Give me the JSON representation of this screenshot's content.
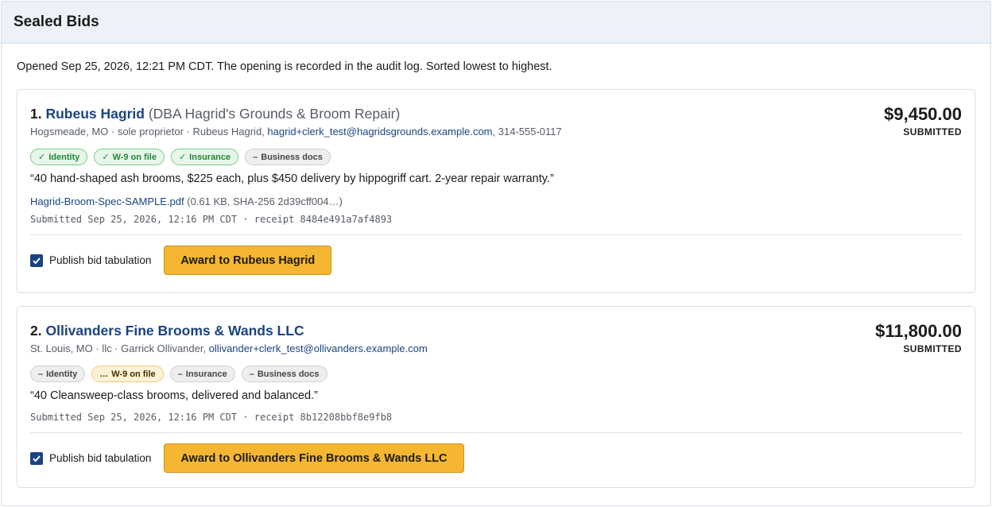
{
  "panel": {
    "title": "Sealed Bids",
    "intro": "Opened Sep 25, 2026, 12:21 PM CDT. The opening is recorded in the audit log. Sorted lowest to highest."
  },
  "bids": [
    {
      "rank": "1.",
      "name": "Rubeus Hagrid",
      "dba": "(DBA Hagrid's Grounds & Broom Repair)",
      "meta_prefix": "Hogsmeade, MO · sole proprietor · Rubeus Hagrid,",
      "email": "hagrid+clerk_test@hagridsgrounds.example.com",
      "meta_suffix": ", 314-555-0117",
      "amount": "$9,450.00",
      "status": "SUBMITTED",
      "tags": [
        {
          "mark": "✓",
          "label": "Identity",
          "state": "ok"
        },
        {
          "mark": "✓",
          "label": "W-9 on file",
          "state": "ok"
        },
        {
          "mark": "✓",
          "label": "Insurance",
          "state": "ok"
        },
        {
          "mark": "–",
          "label": "Business docs",
          "state": "none"
        }
      ],
      "quote": "“40 hand-shaped ash brooms, $225 each, plus $450 delivery by hippogriff cart. 2-year repair warranty.”",
      "attachment_name": "Hagrid-Broom-Spec-SAMPLE.pdf",
      "attachment_info": "(0.61 KB, SHA-256 2d39cff004…)",
      "submitted": "Submitted Sep 25, 2026, 12:16 PM CDT · receipt 8484e491a7af4893",
      "publish_label": "Publish bid tabulation",
      "award_label": "Award to Rubeus Hagrid"
    },
    {
      "rank": "2.",
      "name": "Ollivanders Fine Brooms & Wands LLC",
      "meta_prefix": "St. Louis, MO · llc · Garrick Ollivander,",
      "email": "ollivander+clerk_test@ollivanders.example.com",
      "amount": "$11,800.00",
      "status": "SUBMITTED",
      "tags": [
        {
          "mark": "–",
          "label": "Identity",
          "state": "none"
        },
        {
          "mark": "…",
          "label": "W-9 on file",
          "state": "pending"
        },
        {
          "mark": "–",
          "label": "Insurance",
          "state": "none"
        },
        {
          "mark": "–",
          "label": "Business docs",
          "state": "none"
        }
      ],
      "quote": "“40 Cleansweep-class brooms, delivered and balanced.”",
      "submitted": "Submitted Sep 25, 2026, 12:16 PM CDT · receipt 8b12208bbf8e9fb8",
      "publish_label": "Publish bid tabulation",
      "award_label": "Award to Ollivanders Fine Brooms & Wands LLC"
    }
  ]
}
